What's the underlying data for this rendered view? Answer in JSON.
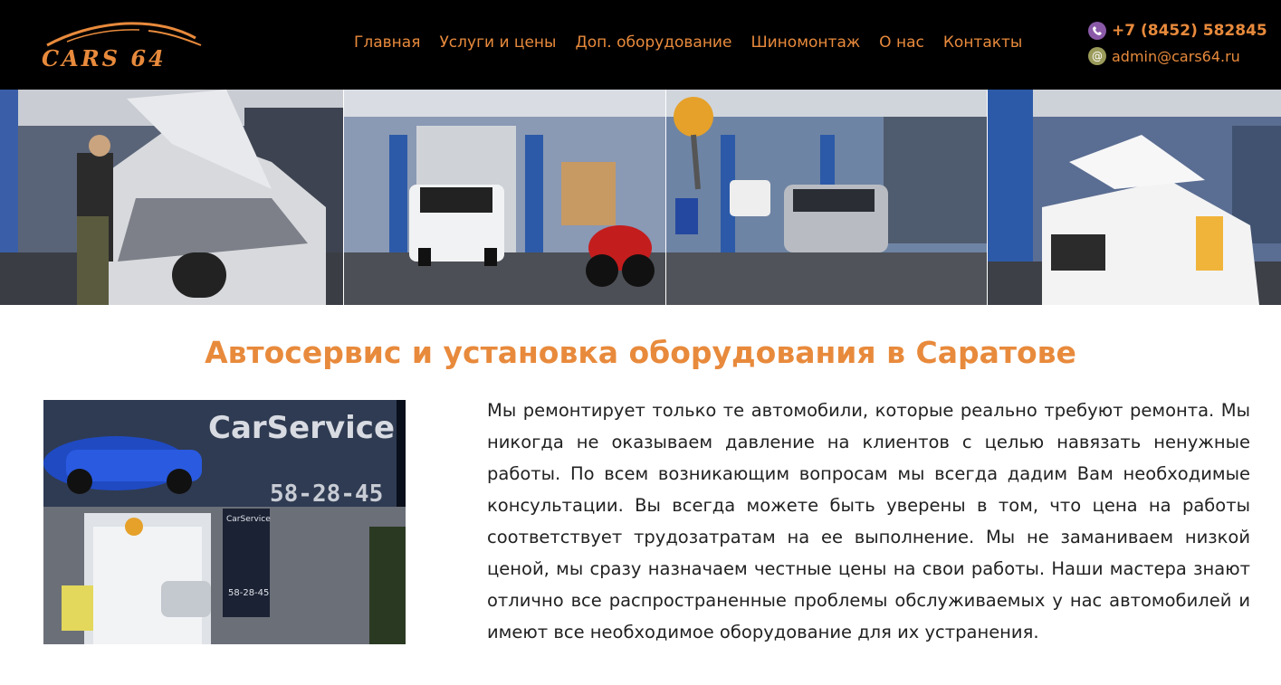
{
  "header": {
    "logo_text": "CARS 64",
    "nav": [
      {
        "label": "Главная"
      },
      {
        "label": "Услуги и цены"
      },
      {
        "label": "Доп. оборудование"
      },
      {
        "label": "Шиномонтаж"
      },
      {
        "label": "О нас"
      },
      {
        "label": "Контакты"
      }
    ],
    "phone": "+7 (8452) 582845",
    "email": "admin@cars64.ru",
    "icons": {
      "phone": "viber-phone-icon",
      "email": "email-at-icon"
    }
  },
  "photos": [
    {
      "name": "mechanic-under-hood-photo"
    },
    {
      "name": "service-bay-white-suv-photo"
    },
    {
      "name": "service-bay-two-cars-photo"
    },
    {
      "name": "white-car-open-hood-photo"
    }
  ],
  "main": {
    "title": "Автосервис и установка оборудования в Саратове",
    "service_photo": {
      "sign_text": "CarService",
      "sign_phone": "58-28-45",
      "small_sign": "CarService",
      "small_phone": "58-28-45"
    },
    "paragraph": "Мы ремонтирует только те автомобили, которые реально требуют ремонта. Мы никогда не оказываем давление на клиентов с целью навязать ненужные работы. По всем возникающим вопросам мы всегда дадим Вам необходимые консультации. Вы всегда можете быть уверены в том, что цена на работы соответствует трудозатратам на ее выполнение. Мы не заманиваем низкой ценой, мы сразу назначаем честные цены на свои работы. Наши мастера знают отлично все распространенные проблемы обслуживаемых у нас автомобилей и имеют все необходимое оборудование для их устранения."
  },
  "colors": {
    "accent": "#e88a3c",
    "header_bg": "#000000",
    "text": "#222222"
  }
}
